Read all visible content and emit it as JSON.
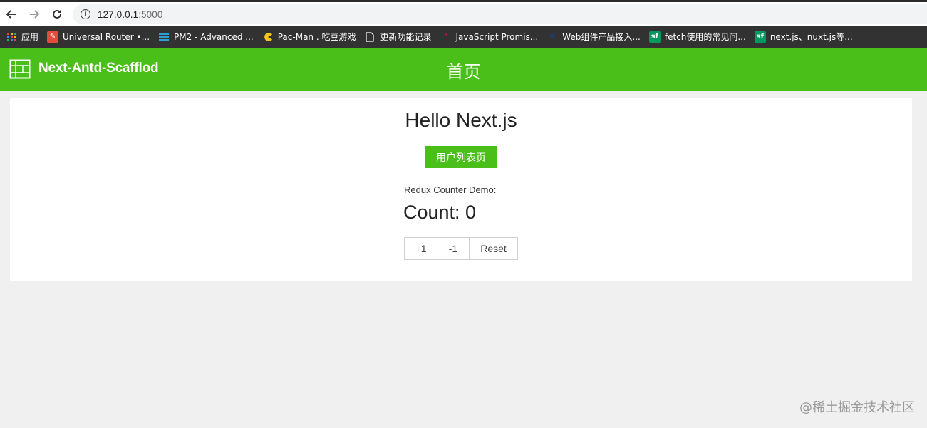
{
  "browser": {
    "url_host": "127.0.0.1",
    "url_port": ":5000",
    "bookmarks": [
      {
        "label": "应用",
        "icon": "apps-grid-icon"
      },
      {
        "label": "Universal Router •...",
        "icon": "pdf-icon"
      },
      {
        "label": "PM2 - Advanced ...",
        "icon": "pm2-icon"
      },
      {
        "label": "Pac-Man . 吃豆游戏",
        "icon": "pacman-icon"
      },
      {
        "label": "更新功能记录",
        "icon": "document-icon"
      },
      {
        "label": "JavaScript Promis...",
        "icon": "js-icon"
      },
      {
        "label": "Web组件产品接入...",
        "icon": "puzzle-icon"
      },
      {
        "label": "fetch使用的常见问...",
        "icon": "sf-icon"
      },
      {
        "label": "next.js、nuxt.js等...",
        "icon": "sf-icon"
      }
    ]
  },
  "header": {
    "logo_text": "Next-Antd-Scafflod",
    "title": "首页"
  },
  "main": {
    "hello": "Hello Next.js",
    "user_list_button": "用户列表页",
    "demo_label": "Redux Counter Demo:",
    "count_text": "Count: 0",
    "buttons": {
      "inc": "+1",
      "dec": "-1",
      "reset": "Reset"
    }
  },
  "watermark": "@稀土掘金技术社区",
  "colors": {
    "brand": "#4abe19",
    "bookmark_bar": "#323232",
    "page_bg": "#f0f0f0"
  }
}
